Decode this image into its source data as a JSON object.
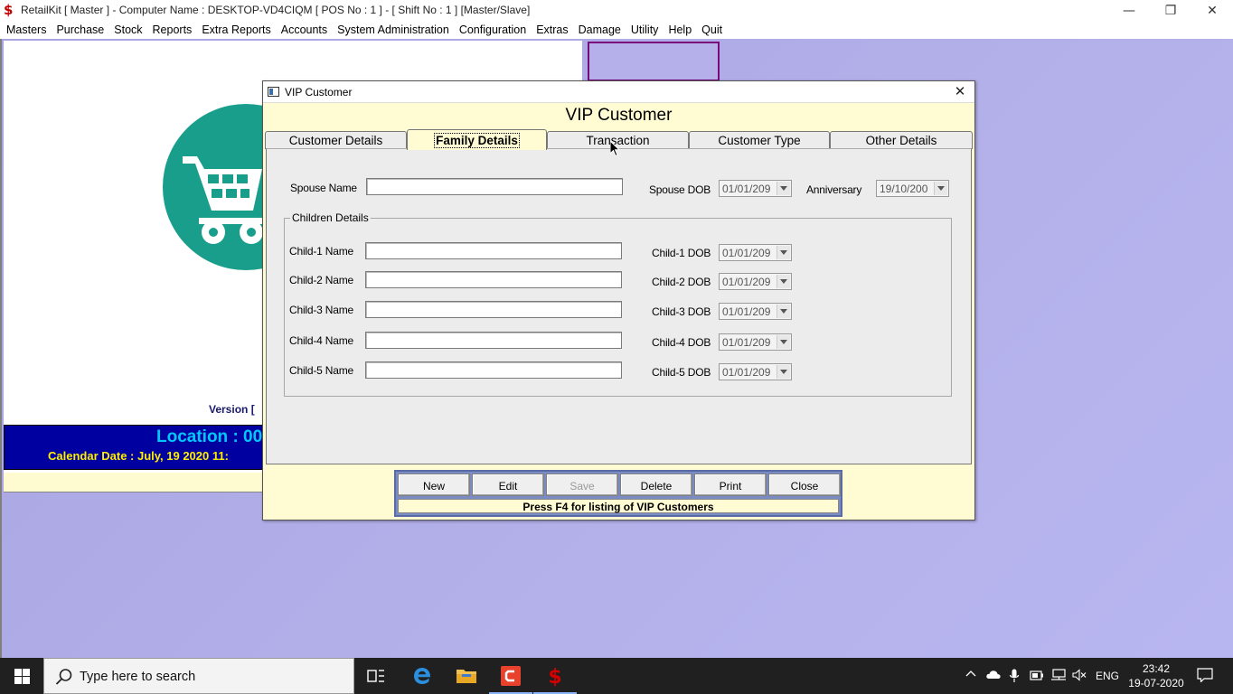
{
  "window": {
    "title": "RetailKit [ Master ] - Computer Name : DESKTOP-VD4CIQM [ POS No : 1 ] - [ Shift No : 1 ]  [Master/Slave]",
    "minimize_glyph": "—",
    "maximize_glyph": "❐",
    "close_glyph": "✕"
  },
  "menubar": {
    "items": [
      "Masters",
      "Purchase",
      "Stock",
      "Reports",
      "Extra Reports",
      "Accounts",
      "System Administration",
      "Configuration",
      "Extras",
      "Damage",
      "Utility",
      "Help",
      "Quit"
    ]
  },
  "background": {
    "version_text": "Version [",
    "location_text": "Location : 00",
    "calendar_text": "Calendar Date : July, 19 2020 11:"
  },
  "dialog": {
    "title": "VIP Customer",
    "close_glyph": "✕",
    "heading": "VIP Customer",
    "tabs": [
      {
        "label": "Customer Details",
        "active": false
      },
      {
        "label": "Family Details",
        "active": true
      },
      {
        "label": "Transaction",
        "active": false
      },
      {
        "label": "Customer Type",
        "active": false
      },
      {
        "label": "Other Details",
        "active": false
      }
    ],
    "family": {
      "spouse_name_label": "Spouse Name",
      "spouse_name_value": "",
      "spouse_dob_label": "Spouse DOB",
      "spouse_dob_value": "01/01/209",
      "anniversary_label": "Anniversary",
      "anniversary_value": "19/10/200",
      "children_group_label": "Children Details",
      "children": [
        {
          "name_label": "Child-1 Name",
          "name_value": "",
          "dob_label": "Child-1 DOB",
          "dob_value": "01/01/209"
        },
        {
          "name_label": "Child-2 Name",
          "name_value": "",
          "dob_label": "Child-2 DOB",
          "dob_value": "01/01/209"
        },
        {
          "name_label": "Child-3 Name",
          "name_value": "",
          "dob_label": "Child-3 DOB",
          "dob_value": "01/01/209"
        },
        {
          "name_label": "Child-4 Name",
          "name_value": "",
          "dob_label": "Child-4 DOB",
          "dob_value": "01/01/209"
        },
        {
          "name_label": "Child-5 Name",
          "name_value": "",
          "dob_label": "Child-5 DOB",
          "dob_value": "01/01/209"
        }
      ]
    },
    "buttons": [
      {
        "label": "New",
        "enabled": true
      },
      {
        "label": "Edit",
        "enabled": true
      },
      {
        "label": "Save",
        "enabled": false
      },
      {
        "label": "Delete",
        "enabled": true
      },
      {
        "label": "Print",
        "enabled": true
      },
      {
        "label": "Close",
        "enabled": true
      }
    ],
    "hint": "Press F4 for listing of VIP Customers"
  },
  "taskbar": {
    "search_placeholder": "Type here to search",
    "language": "ENG",
    "time": "23:42",
    "date": "19-07-2020"
  },
  "colors": {
    "dialog_bg": "#fffcd4",
    "location_bar": "#0000a0",
    "location_text": "#00c8ff",
    "calendar_text": "#ffee00",
    "logo": "#1a9e8c",
    "workspace": "#b2aee8",
    "taskbar": "#202020"
  }
}
